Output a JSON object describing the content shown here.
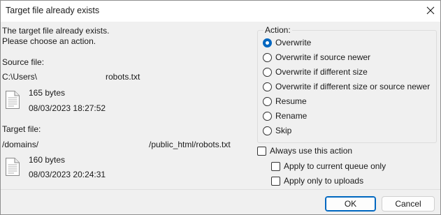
{
  "window": {
    "title": "Target file already exists"
  },
  "message": {
    "line1": "The target file already exists.",
    "line2": "Please choose an action."
  },
  "source": {
    "heading": "Source file:",
    "path_start": "C:\\Users\\",
    "path_end": "robots.txt",
    "size": "165 bytes",
    "date": "08/03/2023 18:27:52",
    "icon": "document-icon"
  },
  "target": {
    "heading": "Target file:",
    "path_start": "/domains/",
    "path_end": "/public_html/robots.txt",
    "size": "160 bytes",
    "date": "08/03/2023 20:24:31",
    "icon": "document-icon"
  },
  "action": {
    "legend": "Action:",
    "options": [
      {
        "label": "Overwrite",
        "checked": true
      },
      {
        "label": "Overwrite if source newer",
        "checked": false
      },
      {
        "label": "Overwrite if different size",
        "checked": false
      },
      {
        "label": "Overwrite if different size or source newer",
        "checked": false
      },
      {
        "label": "Resume",
        "checked": false
      },
      {
        "label": "Rename",
        "checked": false
      },
      {
        "label": "Skip",
        "checked": false
      }
    ]
  },
  "options": {
    "always_use": {
      "label": "Always use this action",
      "checked": false
    },
    "current_queue_only": {
      "label": "Apply to current queue only",
      "checked": false
    },
    "uploads_only": {
      "label": "Apply only to uploads",
      "checked": false
    }
  },
  "buttons": {
    "ok": "OK",
    "cancel": "Cancel"
  },
  "colors": {
    "accent": "#0067c0",
    "dialog_bg": "#f0f0f0",
    "titlebar_bg": "#ffffff"
  }
}
